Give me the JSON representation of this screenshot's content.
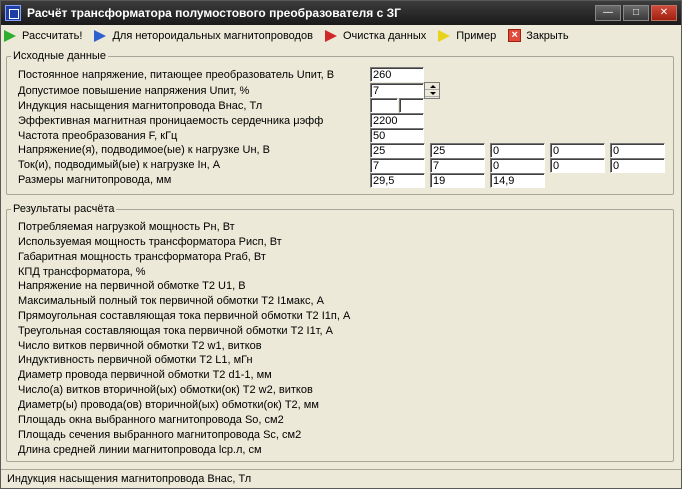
{
  "window": {
    "title": "Расчёт трансформатора полумостового преобразователя с ЗГ",
    "min_glyph": "—",
    "max_glyph": "□",
    "close_glyph": "✕"
  },
  "toolbar": {
    "calculate": "Рассчитать!",
    "non_toroidal": "Для нетороидальных магнитопроводов",
    "clear": "Очистка данных",
    "example": "Пример",
    "close": "Закрыть"
  },
  "input_group": {
    "legend": "Исходные данные",
    "rows": [
      "Постоянное напряжение, питающее преобразователь Uпит, В",
      "Допустимое повышение напряжения Uпит, %",
      "Индукция насыщения магнитопровода Внас, Тл",
      "Эффективная магнитная проницаемость сердечника μэфф",
      "Частота преобразования F, кГц",
      "Напряжение(я), подводимое(ые) к нагрузке Uн, В",
      "Ток(и), подводимый(ые) к нагрузке Iн, А",
      "Размеры магнитопровода, мм"
    ],
    "supply_voltage": "260",
    "voltage_rise": "7",
    "saturation_a": "",
    "saturation_b": "",
    "permeability": "2200",
    "frequency": "50",
    "load_voltages": [
      "25",
      "25",
      "0",
      "0",
      "0"
    ],
    "load_currents": [
      "7",
      "7",
      "0",
      "0",
      "0"
    ],
    "core_dimensions": [
      "29,5",
      "19",
      "14,9"
    ]
  },
  "result_group": {
    "legend": "Результаты расчёта",
    "rows": [
      "Потребляемая нагрузкой мощность Рн, Вт",
      "Используемая мощность трансформатора Рисп, Вт",
      "Габаритная мощность трансформатора Pгаб, Вт",
      "КПД трансформатора, %",
      "Напряжение на первичной обмотке Т2 U1, В",
      "Максимальный полный ток первичной обмотки Т2 I1макс, А",
      "Прямоугольная составляющая тока первичной обмотки Т2 I1п, А",
      "Треугольная составляющая тока первичной обмотки Т2 I1т, А",
      "Число витков первичной обмотки Т2 w1, витков",
      "Индуктивность первичной обмотки Т2 L1, мГн",
      "Диаметр провода первичной обмотки Т2 d1-1, мм",
      "Число(а) витков вторичной(ых) обмотки(ок) Т2 w2, витков",
      "Диаметр(ы) провода(ов) вторичной(ых) обмотки(ок) Т2, мм",
      "Площадь окна выбранного магнитопровода So, см2",
      "Площадь сечения выбранного магнитопровода Sc, см2",
      "Длина средней линии магнитопровода lср.л, см"
    ]
  },
  "statusbar": {
    "text": "Индукция насыщения магнитопровода Внас, Тл"
  }
}
